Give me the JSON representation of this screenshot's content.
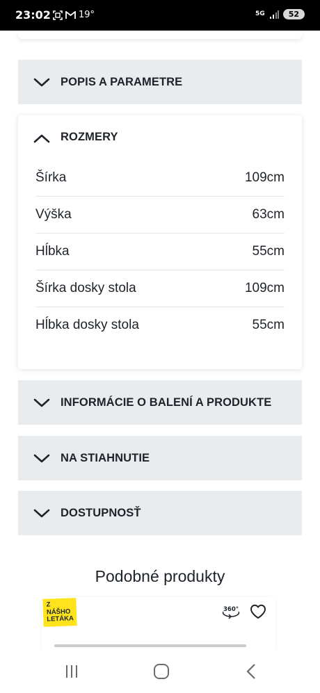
{
  "status_bar": {
    "time": "23:02",
    "temperature": "19°",
    "network": "5G",
    "battery": "52"
  },
  "accordions": {
    "popis": {
      "title": "POPIS A PARAMETRE"
    },
    "rozmery": {
      "title": "ROZMERY",
      "rows": [
        {
          "label": "Šírka",
          "value": "109cm"
        },
        {
          "label": "Výška",
          "value": "63cm"
        },
        {
          "label": "Hĺbka",
          "value": "55cm"
        },
        {
          "label": "Šírka dosky stola",
          "value": "109cm"
        },
        {
          "label": "Hĺbka dosky stola",
          "value": "55cm"
        }
      ]
    },
    "balenie": {
      "title": "INFORMÁCIE O BALENÍ A PRODUKTE"
    },
    "stiahnutie": {
      "title": "NA STIAHNUTIE"
    },
    "dostupnost": {
      "title": "DOSTUPNOSŤ"
    }
  },
  "similar": {
    "title": "Podobné produkty",
    "badge_lines": [
      "Z",
      "NÁŠHO",
      "LETÁKA"
    ],
    "icon_360_label": "360°"
  },
  "colors": {
    "accordion_bg": "#e9ecef",
    "badge_yellow": "#ffe31c",
    "text": "#1e2329"
  }
}
